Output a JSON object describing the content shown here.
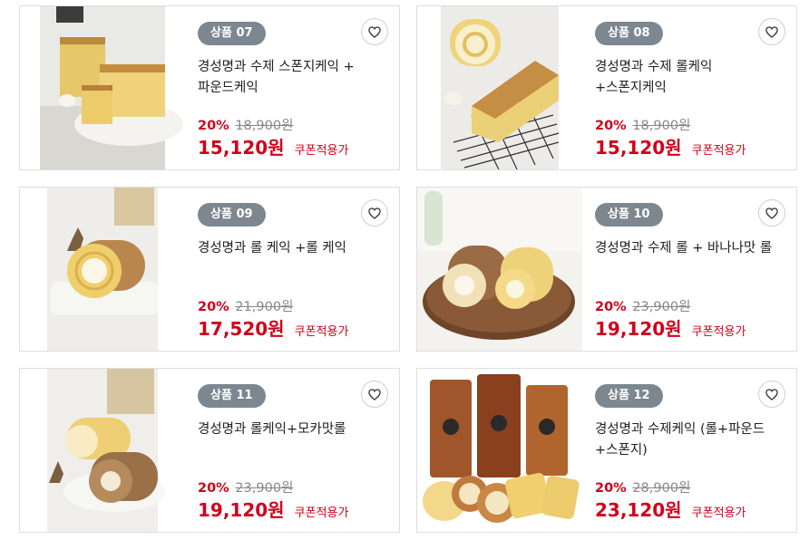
{
  "products": [
    {
      "badge": "상품 07",
      "title": "경성명과 수제 스폰지케익 + 파운드케익",
      "discount": "20%",
      "original_price": "18,900원",
      "price": "15,120원",
      "coupon": "쿠폰적용가",
      "image": "sponge-pound-cake-photo"
    },
    {
      "badge": "상품 08",
      "title": "경성명과 수제 롤케익+스폰지케익",
      "discount": "20%",
      "original_price": "18,900원",
      "price": "15,120원",
      "coupon": "쿠폰적용가",
      "image": "roll-sponge-cake-photo"
    },
    {
      "badge": "상품 09",
      "title": "경성명과 롤 케익 +롤 케익",
      "discount": "20%",
      "original_price": "21,900원",
      "price": "17,520원",
      "coupon": "쿠폰적용가",
      "image": "roll-cake-photo"
    },
    {
      "badge": "상품 10",
      "title": "경성명과 수제 롤 + 바나나맛 롤",
      "discount": "20%",
      "original_price": "23,900원",
      "price": "19,120원",
      "coupon": "쿠폰적용가",
      "image": "banana-roll-photo"
    },
    {
      "badge": "상품 11",
      "title": "경성명과 롤케익+모카맛롤",
      "discount": "20%",
      "original_price": "23,900원",
      "price": "19,120원",
      "coupon": "쿠폰적용가",
      "image": "mocha-roll-photo"
    },
    {
      "badge": "상품 12",
      "title": "경성명과 수제케익 (롤+파운드+스폰지)",
      "discount": "20%",
      "original_price": "28,900원",
      "price": "23,120원",
      "coupon": "쿠폰적용가",
      "image": "assorted-cake-photo"
    }
  ],
  "colors": {
    "accent": "#d0021b",
    "badge_bg": "#7d8790",
    "border": "#dedede"
  }
}
